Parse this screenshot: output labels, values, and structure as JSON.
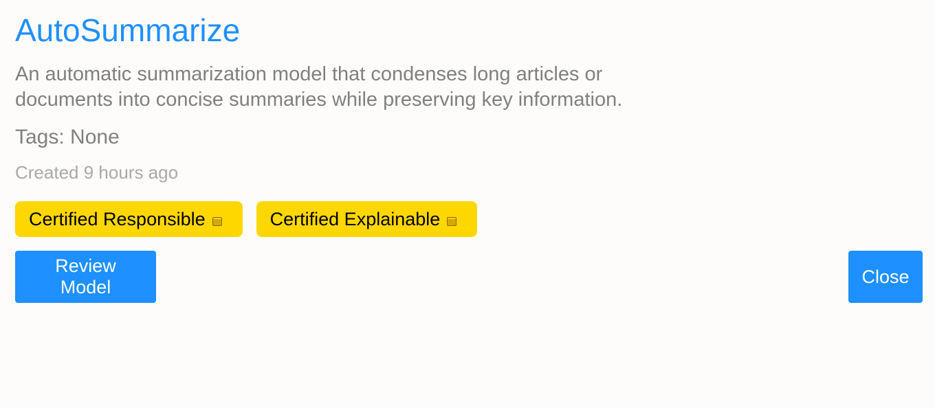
{
  "model": {
    "title": "AutoSummarize",
    "description": "An automatic summarization model that condenses long articles or documents into concise summaries while preserving key information.",
    "tags": "Tags: None",
    "created": "Created 9 hours ago"
  },
  "badges": [
    {
      "label": "Certified Responsible",
      "icon": "medal-icon"
    },
    {
      "label": "Certified Explainable",
      "icon": "medal-icon"
    }
  ],
  "actions": {
    "review_label": "Review Model",
    "close_label": "Close"
  },
  "colors": {
    "accent": "#1e90ff",
    "badge": "#ffd700",
    "text_muted": "#808080",
    "text_light": "#a9a9a9",
    "background": "#fdfcfa"
  }
}
